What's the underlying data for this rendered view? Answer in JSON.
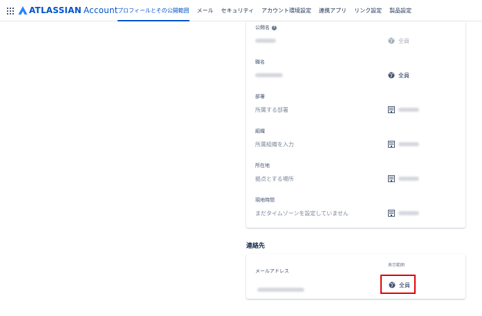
{
  "brand": {
    "name": "ATLASSIAN",
    "product": "Account"
  },
  "nav": {
    "tabs": [
      {
        "label": "プロフィールとその公開範囲",
        "active": true
      },
      {
        "label": "メール"
      },
      {
        "label": "セキュリティ"
      },
      {
        "label": "アカウント環境設定"
      },
      {
        "label": "連携アプリ"
      },
      {
        "label": "リンク設定"
      },
      {
        "label": "製品設定"
      }
    ]
  },
  "profile_fields": [
    {
      "label": "公開名",
      "has_help": true,
      "value": "",
      "visibility": "全員",
      "visibility_icon": "globe-icon",
      "faded": true
    },
    {
      "label": "職名",
      "value": "",
      "visibility": "全員",
      "visibility_icon": "globe-icon"
    },
    {
      "label": "部署",
      "value": "所属する部署",
      "visibility": "",
      "visibility_icon": "building-icon"
    },
    {
      "label": "組織",
      "value": "所属組織を入力",
      "visibility": "",
      "visibility_icon": "building-icon"
    },
    {
      "label": "所在地",
      "value": "拠点とする場所",
      "visibility": "",
      "visibility_icon": "building-icon"
    },
    {
      "label": "現地時間",
      "value": "まだタイムゾーンを設定していません",
      "visibility": "",
      "visibility_icon": "building-icon"
    }
  ],
  "contact": {
    "title": "連絡先",
    "visibility_header": "表示範囲",
    "email_label": "メールアドレス",
    "email_value": "",
    "visibility": "全員"
  },
  "colors": {
    "accent": "#0052cc",
    "highlight": "#e00000",
    "text": "#172b4d"
  }
}
